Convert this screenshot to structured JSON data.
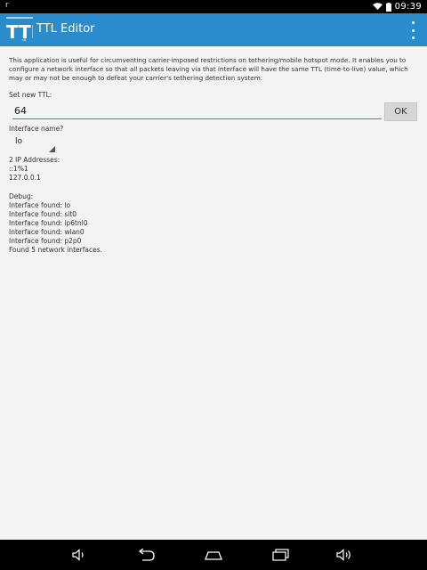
{
  "status_bar": {
    "notification_glyph": "r",
    "time": "09:39",
    "icons": [
      "wifi-icon",
      "battery-icon"
    ]
  },
  "action_bar": {
    "logo_text": "TTL",
    "logo_subtext": "Editor",
    "title": "TTL Editor",
    "menu_icon": "overflow-menu-icon",
    "color": "#2b8ccd"
  },
  "main": {
    "description": "This application is useful for circumventing carrier-imposed restrictions on tethering/mobile hotspot mode. It enables you to configure a network interface so that all packets leaving via that interface will have the same TTL (time-to-live) value, which may or may not be enough to defeat your carrier's tethering detection system.",
    "ttl_label": "Set new TTL:",
    "ttl_value": "64",
    "ok_label": "OK",
    "interface_label": "Interface name?",
    "interface_selected": "lo",
    "ip_header": "2 IP Addresses:",
    "ip_addresses": [
      "::1%1",
      "127.0.0.1"
    ],
    "debug_header": "Debug:",
    "debug_lines": [
      "Interface found: lo",
      "Interface found: sit0",
      "Interface found: ip6tnl0",
      "Interface found: wlan0",
      "Interface found: p2p0",
      "Found 5 network interfaces."
    ]
  },
  "nav_bar": {
    "buttons": [
      "volume-down-icon",
      "back-icon",
      "home-icon",
      "recents-icon",
      "volume-up-icon"
    ]
  }
}
